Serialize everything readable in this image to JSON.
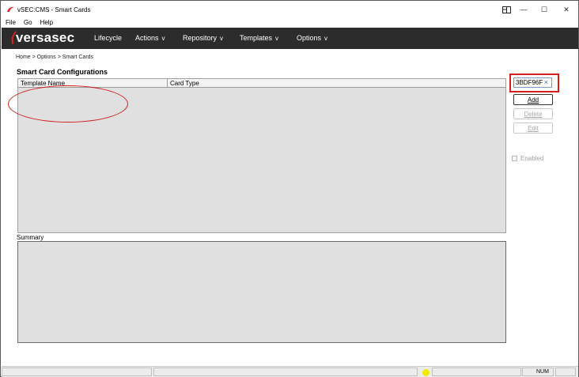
{
  "window": {
    "title": "vSEC:CMS - Smart Cards",
    "controls": {
      "snap_icon": "snap-layout-icon",
      "minimize": "—",
      "maximize": "☐",
      "close": "✕"
    }
  },
  "menubar": {
    "items": [
      "File",
      "Go",
      "Help"
    ]
  },
  "navbar": {
    "logo": "versasec",
    "items": [
      {
        "label": "Lifecycle",
        "chevron": ""
      },
      {
        "label": "Actions",
        "chevron": "v"
      },
      {
        "label": "Repository",
        "chevron": "v"
      },
      {
        "label": "Templates",
        "chevron": "v"
      },
      {
        "label": "Options",
        "chevron": "v"
      }
    ]
  },
  "breadcrumb": "Home > Options > Smart Cards",
  "page_title": "Smart Card Configurations",
  "grid": {
    "columns": [
      "Template Name",
      "Card Type"
    ],
    "rows": []
  },
  "summary": {
    "label": "Summary",
    "text": ""
  },
  "right_panel": {
    "chip": {
      "value": "3BDF96F",
      "close": "×"
    },
    "buttons": {
      "add": "Add",
      "delete": "Delete",
      "edit": "Edit"
    },
    "enabled_label": "Enabled"
  },
  "statusbar": {
    "num": "NUM"
  },
  "colors": {
    "nav_bg": "#2c2c2c",
    "annotation_red": "#d21f1f",
    "grid_bg": "#e0e0e0",
    "status_dot": "#f2ea00"
  }
}
